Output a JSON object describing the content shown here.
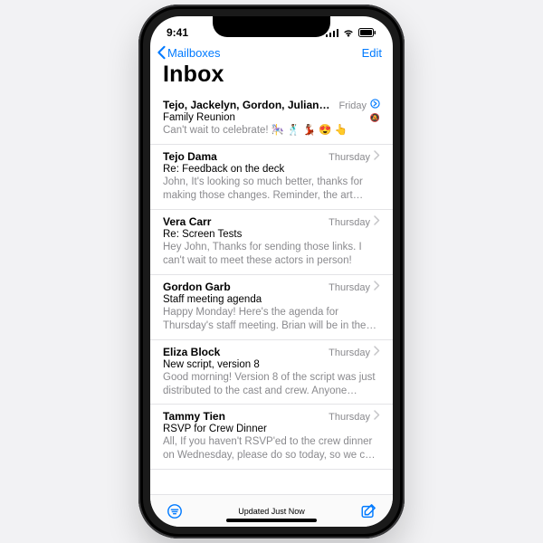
{
  "status": {
    "time": "9:41"
  },
  "nav": {
    "back": "Mailboxes",
    "edit": "Edit"
  },
  "title": "Inbox",
  "messages": [
    {
      "sender": "Tejo, Jackelyn, Gordon, Juliana...",
      "date": "Friday",
      "subject": "Family Reunion",
      "preview": "Can't wait to celebrate! 🎠 🕺🏽 💃🏽 😍 👆",
      "accessory": true,
      "muted": true
    },
    {
      "sender": "Tejo Dama",
      "date": "Thursday",
      "subject": "Re: Feedback on the deck",
      "preview": "John, It's looking so much better, thanks for making those changes. Reminder, the art direc…"
    },
    {
      "sender": "Vera Carr",
      "date": "Thursday",
      "subject": "Re: Screen Tests",
      "preview": "Hey John, Thanks for sending those links. I can't wait to meet these actors in person!"
    },
    {
      "sender": "Gordon Garb",
      "date": "Thursday",
      "subject": "Staff meeting agenda",
      "preview": "Happy Monday! Here's the agenda for Thursday's staff meeting. Brian will be in the ai…"
    },
    {
      "sender": "Eliza Block",
      "date": "Thursday",
      "subject": "New script, version 8",
      "preview": "Good morning! Version 8 of the script was just distributed to the cast and crew. Anyone sche…"
    },
    {
      "sender": "Tammy Tien",
      "date": "Thursday",
      "subject": "RSVP for Crew Dinner",
      "preview": "All, If you haven't RSVP'ed to the crew dinner on Wednesday, please do so today, so we can be…"
    }
  ],
  "toolbar": {
    "status": "Updated Just Now"
  }
}
